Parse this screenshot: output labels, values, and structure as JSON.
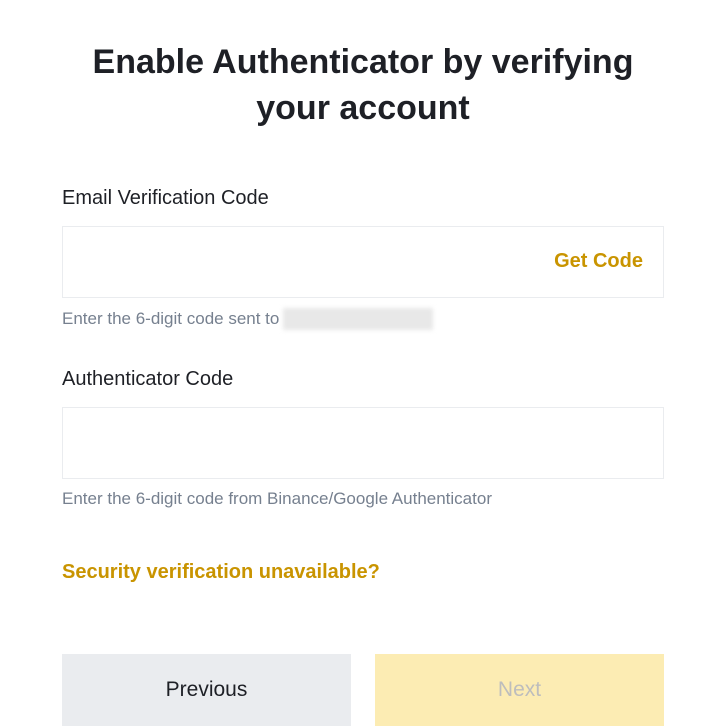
{
  "title": "Enable Authenticator by verifying your account",
  "emailSection": {
    "label": "Email Verification Code",
    "getCodeLabel": "Get Code",
    "helperPrefix": "Enter the 6-digit code sent to "
  },
  "authSection": {
    "label": "Authenticator Code",
    "helper": "Enter the 6-digit code from Binance/Google Authenticator"
  },
  "securityLink": "Security verification unavailable?",
  "buttons": {
    "previous": "Previous",
    "next": "Next"
  }
}
